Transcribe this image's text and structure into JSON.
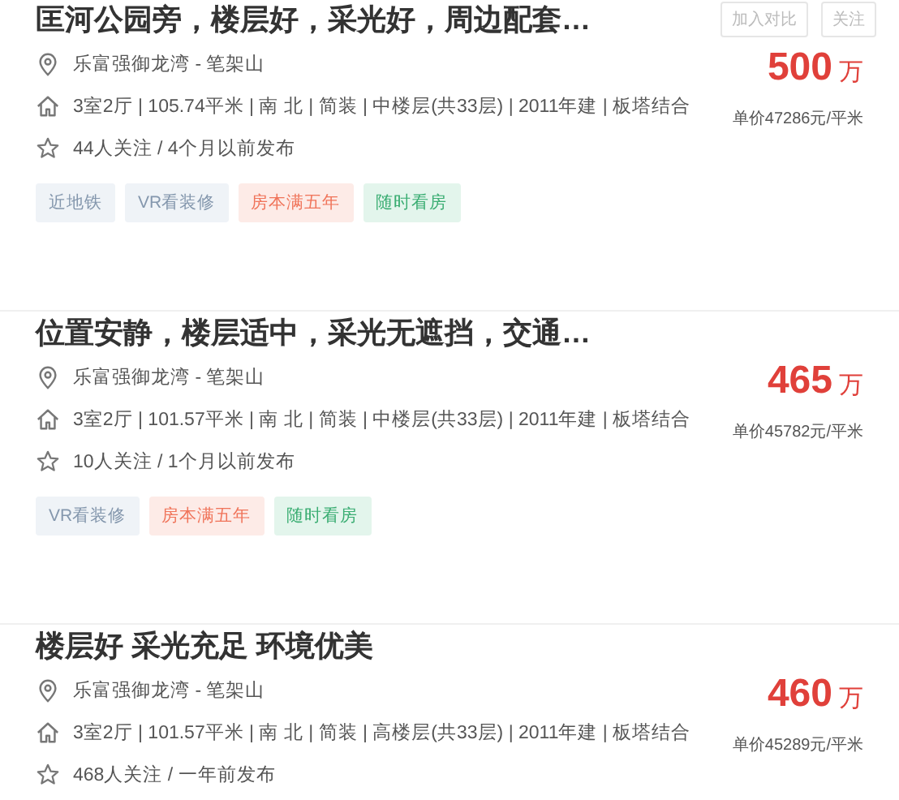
{
  "listings": [
    {
      "title": "匡河公园旁，楼层好，采光好，周边配套…",
      "buttons": [
        "加入对比",
        "关注"
      ],
      "address": "乐富强御龙湾 - 笔架山",
      "info": "3室2厅 | 105.74平米 | 南 北 | 简装 | 中楼层(共33层) | 2011年建 | 板塔结合",
      "follow": "44人关注 / 4个月以前发布",
      "price": "500",
      "price_unit": "万",
      "unit_price": "单价47286元/平米",
      "tags": [
        {
          "label": "近地铁",
          "kind": "plain"
        },
        {
          "label": "VR看装修",
          "kind": "plain"
        },
        {
          "label": "房本满五年",
          "kind": "taxfree"
        },
        {
          "label": "随时看房",
          "kind": "viewing"
        }
      ]
    },
    {
      "title": "位置安静，楼层适中，采光无遮挡，交通…",
      "address": "乐富强御龙湾 - 笔架山",
      "info": "3室2厅 | 101.57平米 | 南 北 | 简装 | 中楼层(共33层) | 2011年建 | 板塔结合",
      "follow": "10人关注 / 1个月以前发布",
      "price": "465",
      "price_unit": "万",
      "unit_price": "单价45782元/平米",
      "tags": [
        {
          "label": "VR看装修",
          "kind": "plain"
        },
        {
          "label": "房本满五年",
          "kind": "taxfree"
        },
        {
          "label": "随时看房",
          "kind": "viewing"
        }
      ]
    },
    {
      "title": "楼层好 采光充足 环境优美",
      "address": "乐富强御龙湾 - 笔架山",
      "info": "3室2厅 | 101.57平米 | 南 北 | 简装 | 高楼层(共33层) | 2011年建 | 板塔结合",
      "follow": "468人关注 / 一年前发布",
      "price": "460",
      "price_unit": "万",
      "unit_price": "单价45289元/平米"
    }
  ]
}
